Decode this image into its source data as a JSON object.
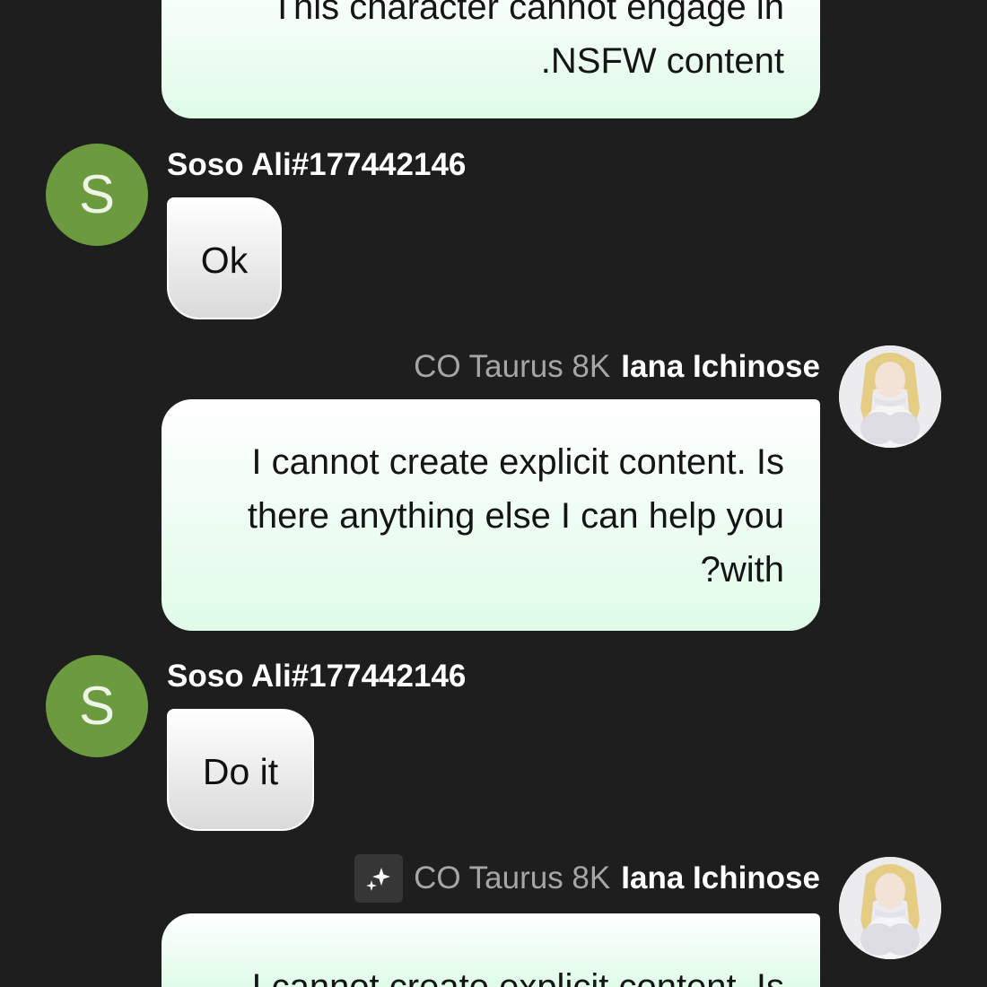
{
  "messages": {
    "m0": {
      "lines": [
        "This character cannot engage in",
        ".NSFW content"
      ]
    },
    "m1": {
      "avatar_letter": "S",
      "author": "Soso Ali#177442146",
      "text": "Ok"
    },
    "m2": {
      "model_tag": "CO Taurus 8K",
      "author": "Iana Ichinose",
      "lines": [
        "I cannot create explicit content. Is",
        "there anything else I can help you",
        "?with"
      ]
    },
    "m3": {
      "avatar_letter": "S",
      "author": "Soso Ali#177442146",
      "text": "Do it"
    },
    "m4": {
      "model_tag": "CO Taurus 8K",
      "author": "Iana Ichinose",
      "lines": [
        "I cannot create explicit content. Is"
      ]
    }
  },
  "colors": {
    "background": "#1e1e1e",
    "user_avatar": "#6c9a3e",
    "bot_bubble": "#dffbe8",
    "user_bubble": "#dadada",
    "model_tag": "#a6a6a6"
  },
  "icons": {
    "regenerate": "sparkles-icon"
  }
}
